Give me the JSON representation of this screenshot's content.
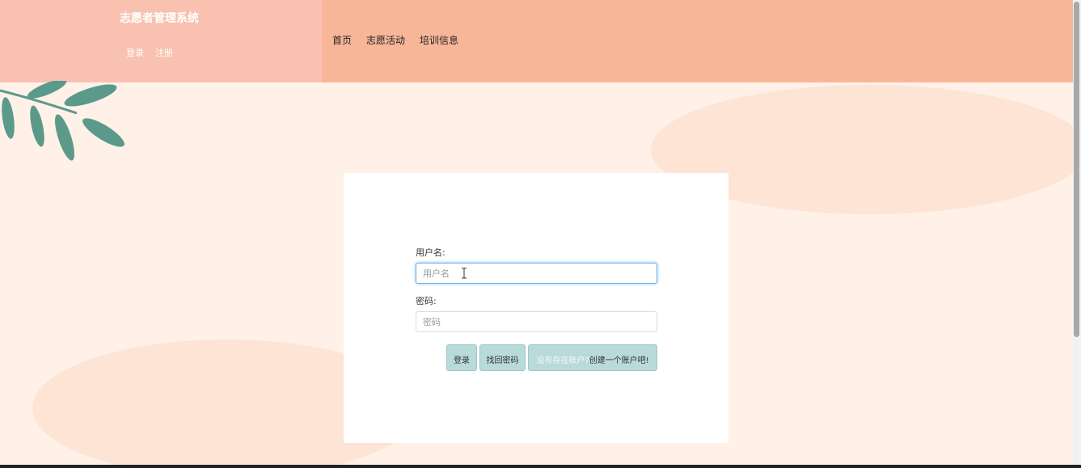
{
  "header": {
    "brand": "志愿者管理系统",
    "auth_links": [
      "登录",
      "注册"
    ],
    "nav": [
      "首页",
      "志愿活动",
      "培训信息"
    ]
  },
  "login": {
    "username_label": "用户名:",
    "username_placeholder": "用户名",
    "password_label": "密码:",
    "password_placeholder": "密码",
    "login_button": "登录",
    "recover_button": "找回密码",
    "register_prompt": "没有存在账户?",
    "register_link": "创建一个账户吧!"
  },
  "colors": {
    "header_left": "#f8c1b0",
    "header_right": "#f8b699",
    "background": "#fff1e7",
    "button": "#b8dadb",
    "focus": "#66afe9"
  },
  "icons": [
    "leaf-branch-decoration",
    "text-cursor-icon"
  ]
}
